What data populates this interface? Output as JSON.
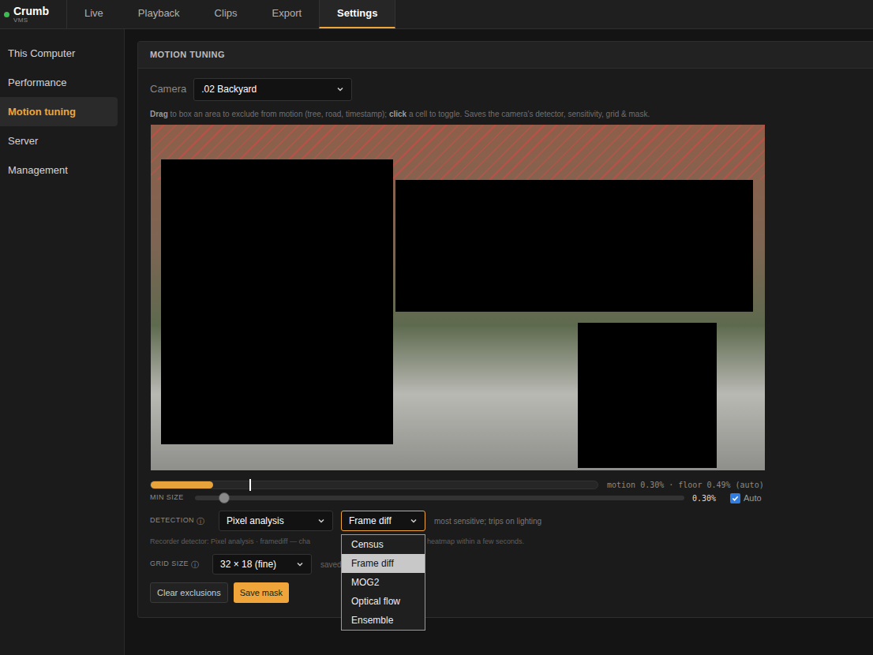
{
  "app": {
    "name": "Crumb",
    "subtitle": "VMS",
    "online": true
  },
  "tabs": [
    {
      "label": "Live",
      "selected": false
    },
    {
      "label": "Playback",
      "selected": false
    },
    {
      "label": "Clips",
      "selected": false
    },
    {
      "label": "Export",
      "selected": false
    },
    {
      "label": "Settings",
      "selected": true
    }
  ],
  "sidebar": {
    "items": [
      {
        "label": "This Computer",
        "selected": false
      },
      {
        "label": "Performance",
        "selected": false
      },
      {
        "label": "Motion tuning",
        "selected": true
      },
      {
        "label": "Server",
        "selected": false
      },
      {
        "label": "Management",
        "selected": false
      }
    ]
  },
  "panel": {
    "title": "MOTION TUNING",
    "camera": {
      "label": "Camera",
      "value": ".02 Backyard"
    },
    "instructions": [
      {
        "text": "Drag",
        "bold": true
      },
      {
        "text": " to box an area to exclude from motion (tree, road, timestamp); ",
        "bold": false
      },
      {
        "text": "click",
        "bold": true
      },
      {
        "text": " a cell to toggle. Saves the camera's detector, sensitivity, grid & mask.",
        "bold": false
      }
    ],
    "meter": {
      "level": 0.14,
      "floor_level": 0.22,
      "reading": "motion 0.30% · floor 0.49% (auto)"
    },
    "min_size": {
      "label": "MIN SIZE",
      "level": 0.06,
      "reading": "0.30%",
      "auto": {
        "label": "Auto",
        "checked": true
      }
    },
    "detection": {
      "label": "DETECTION",
      "info": "ⓘ",
      "mode": "Pixel analysis",
      "algorithm": {
        "value": "Frame diff",
        "expanded": true,
        "options": [
          {
            "label": "Census",
            "selected": false
          },
          {
            "label": "Frame diff",
            "selected": true
          },
          {
            "label": "MOG2",
            "selected": false
          },
          {
            "label": "Optical flow",
            "selected": false
          },
          {
            "label": "Ensemble",
            "selected": false
          }
        ]
      },
      "hint": "most sensitive; trips on lighting"
    },
    "recorder_note": [
      "Recorder detector: Pixel analysis · framediff — cha",
      "heatmap within a few seconds."
    ],
    "grid": {
      "label": "GRID SIZE",
      "info": "ⓘ",
      "value": "32 × 18 (fine)",
      "note": "saved"
    },
    "buttons": [
      {
        "label": "Clear exclusions",
        "primary": false
      },
      {
        "label": "Save mask",
        "primary": true
      }
    ]
  }
}
